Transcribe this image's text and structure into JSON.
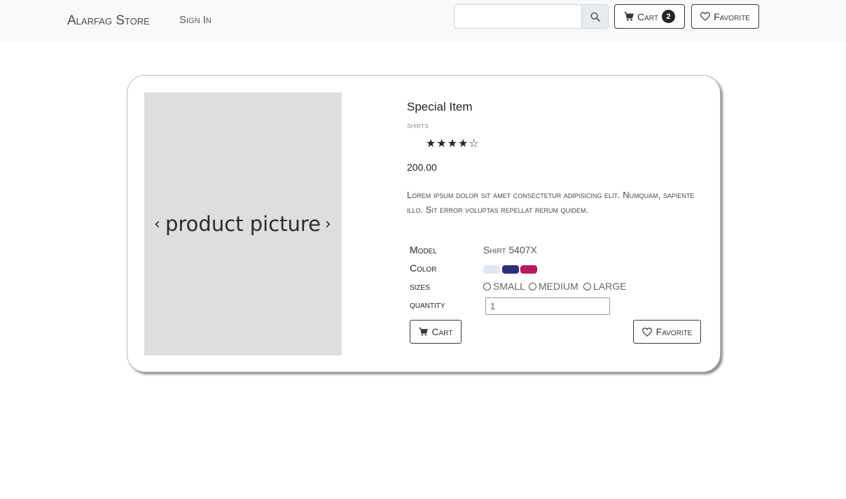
{
  "navbar": {
    "brand": "Alarfag Store",
    "sign_in": "Sign In",
    "search": {
      "value": "",
      "placeholder": ""
    },
    "cart_label": "Cart",
    "cart_count": "2",
    "favorite_label": "Favorite"
  },
  "product": {
    "picture_label": "product picture",
    "prev_arrow": "‹",
    "next_arrow": "›",
    "title": "Special Item",
    "category": "shirts",
    "rating": {
      "value": 4,
      "max": 5
    },
    "stars_display": "★★★★☆",
    "price": "200.00",
    "description": "Lorem ipsum dolor sit amet consectetur adipisicing elit. Numquam, sapiente illo. Sit error voluptas repellat rerum quidem.",
    "specs": {
      "model_label": "Model",
      "model_value": "Shirt 5407X",
      "color_label": "Color",
      "colors": [
        "#e3e6f7",
        "#2c2f7a",
        "#b81b5f"
      ],
      "sizes_label": "sizes",
      "sizes": [
        "SMALL",
        "MEDIUM",
        "LARGE"
      ],
      "quantity_label": "quantity",
      "quantity_value": "1"
    },
    "cart_button": "Cart",
    "favorite_button": "Favorite"
  }
}
